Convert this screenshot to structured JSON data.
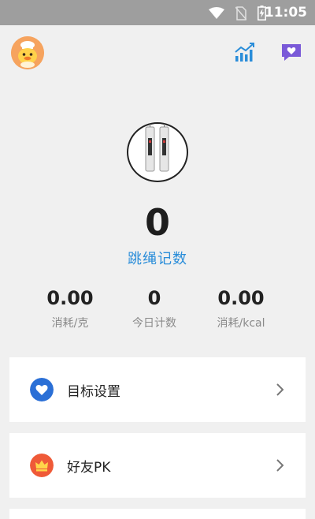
{
  "status_bar": {
    "time": "11:05",
    "icons": [
      "wifi-icon",
      "no-sim-icon",
      "battery-charging-icon"
    ]
  },
  "header": {
    "left": "avatar",
    "right_icons": [
      "chart-icon",
      "chat-heart-icon"
    ]
  },
  "main": {
    "count": "0",
    "count_label": "跳绳记数",
    "stats": [
      {
        "value": "0.00",
        "label": "消耗/克"
      },
      {
        "value": "0",
        "label": "今日计数"
      },
      {
        "value": "0.00",
        "label": "消耗/kcal"
      }
    ]
  },
  "menu": [
    {
      "label": "目标设置",
      "icon": "heart-icon",
      "color": "#2a6fd6"
    },
    {
      "label": "好友PK",
      "icon": "crown-icon",
      "color": "#ef5a38"
    }
  ],
  "colors": {
    "accent_blue": "#2a8dd9",
    "status_bar": "#9e9e9e",
    "background": "#f0f0f0"
  }
}
